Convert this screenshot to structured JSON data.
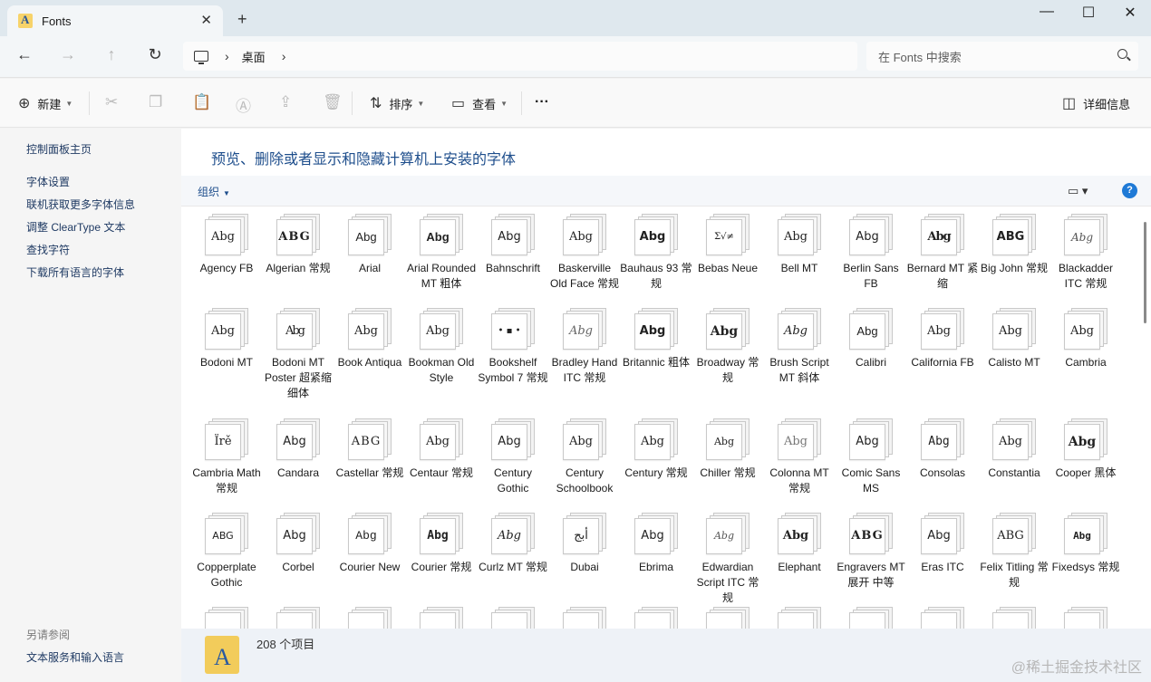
{
  "window": {
    "tab_title": "Fonts",
    "tab_close": "✕",
    "new_tab": "+",
    "minimize": "—",
    "maximize": "☐",
    "close": "✕"
  },
  "nav": {
    "back": "←",
    "forward": "→",
    "up": "↑",
    "refresh": "↻",
    "breadcrumb_sep": "›",
    "breadcrumb": "桌面",
    "search_placeholder": "在 Fonts 中搜索"
  },
  "toolbar": {
    "new_label": "新建",
    "sort_label": "排序",
    "view_label": "查看",
    "more": "···",
    "details_label": "详细信息"
  },
  "sidebar": {
    "home": "控制面板主页",
    "links": [
      "字体设置",
      "联机获取更多字体信息",
      "调整 ClearType 文本",
      "查找字符",
      "下载所有语言的字体"
    ],
    "see_also": "另请参阅",
    "see_also_link": "文本服务和输入语言"
  },
  "main": {
    "heading": "预览、删除或者显示和隐藏计算机上安装的字体",
    "organize": "组织",
    "help": "?",
    "view_icon": "▭ ▾"
  },
  "fonts": [
    {
      "name": "Agency FB",
      "glyph": "Abg"
    },
    {
      "name": "Algerian 常规",
      "glyph": "ABG"
    },
    {
      "name": "Arial",
      "glyph": "Abg"
    },
    {
      "name": "Arial Rounded MT 粗体",
      "glyph": "Abg"
    },
    {
      "name": "Bahnschrift",
      "glyph": "Abg"
    },
    {
      "name": "Baskerville Old Face 常规",
      "glyph": "Abg"
    },
    {
      "name": "Bauhaus 93 常规",
      "glyph": "Abg"
    },
    {
      "name": "Bebas Neue",
      "glyph": "Σ√≠"
    },
    {
      "name": "Bell MT",
      "glyph": "Abg"
    },
    {
      "name": "Berlin Sans FB",
      "glyph": "Abg"
    },
    {
      "name": "Bernard MT 紧缩",
      "glyph": "Abg"
    },
    {
      "name": "Big John 常规",
      "glyph": "ABG"
    },
    {
      "name": "Blackadder ITC 常规",
      "glyph": "Abg"
    },
    {
      "name": "Bodoni MT",
      "glyph": "Abg"
    },
    {
      "name": "Bodoni MT Poster 超紧缩 细体",
      "glyph": "Abg"
    },
    {
      "name": "Book Antiqua",
      "glyph": "Abg"
    },
    {
      "name": "Bookman Old Style",
      "glyph": "Abg"
    },
    {
      "name": "Bookshelf Symbol 7 常规",
      "glyph": "• ▪ •"
    },
    {
      "name": "Bradley Hand ITC 常规",
      "glyph": "Abg"
    },
    {
      "name": "Britannic 粗体",
      "glyph": "Abg"
    },
    {
      "name": "Broadway 常规",
      "glyph": "Abg"
    },
    {
      "name": "Brush Script MT 斜体",
      "glyph": "Abg"
    },
    {
      "name": "Calibri",
      "glyph": "Abg"
    },
    {
      "name": "California FB",
      "glyph": "Abg"
    },
    {
      "name": "Calisto MT",
      "glyph": "Abg"
    },
    {
      "name": "Cambria",
      "glyph": "Abg"
    },
    {
      "name": "Cambria Math 常规",
      "glyph": "Ïrě"
    },
    {
      "name": "Candara",
      "glyph": "Abg"
    },
    {
      "name": "Castellar 常规",
      "glyph": "ABG"
    },
    {
      "name": "Centaur 常规",
      "glyph": "Abg"
    },
    {
      "name": "Century Gothic",
      "glyph": "Abg"
    },
    {
      "name": "Century Schoolbook",
      "glyph": "Abg"
    },
    {
      "name": "Century 常规",
      "glyph": "Abg"
    },
    {
      "name": "Chiller 常规",
      "glyph": "Abg"
    },
    {
      "name": "Colonna MT 常规",
      "glyph": "Abg"
    },
    {
      "name": "Comic Sans MS",
      "glyph": "Abg"
    },
    {
      "name": "Consolas",
      "glyph": "Abg"
    },
    {
      "name": "Constantia",
      "glyph": "Abg"
    },
    {
      "name": "Cooper 黑体",
      "glyph": "Abg"
    },
    {
      "name": "Copperplate Gothic",
      "glyph": "ABG"
    },
    {
      "name": "Corbel",
      "glyph": "Abg"
    },
    {
      "name": "Courier New",
      "glyph": "Abg"
    },
    {
      "name": "Courier 常规",
      "glyph": "Abg"
    },
    {
      "name": "Curlz MT 常规",
      "glyph": "Abg"
    },
    {
      "name": "Dubai",
      "glyph": "أبج"
    },
    {
      "name": "Ebrima",
      "glyph": "Abg"
    },
    {
      "name": "Edwardian Script ITC 常规",
      "glyph": "Abg"
    },
    {
      "name": "Elephant",
      "glyph": "Abg"
    },
    {
      "name": "Engravers MT 展开 中等",
      "glyph": "ABG"
    },
    {
      "name": "Eras ITC",
      "glyph": "Abg"
    },
    {
      "name": "Felix Titling 常规",
      "glyph": "ABG"
    },
    {
      "name": "Fixedsys 常规",
      "glyph": "Abg"
    }
  ],
  "status": {
    "count_text": "208 个项目",
    "watermark": "@稀土掘金技术社区"
  }
}
